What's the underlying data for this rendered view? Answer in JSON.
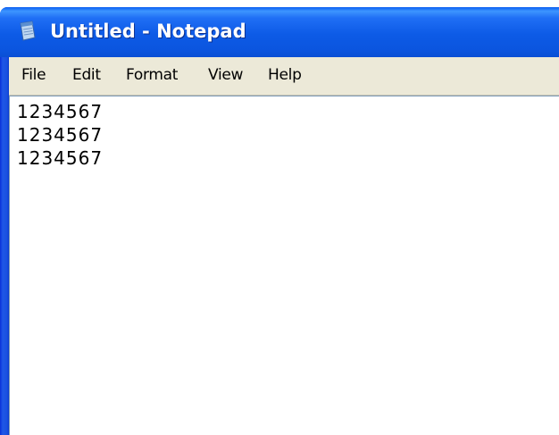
{
  "window": {
    "title": "Untitled - Notepad",
    "icon": "notepad-icon"
  },
  "menu": {
    "items": [
      {
        "label": "File"
      },
      {
        "label": "Edit"
      },
      {
        "label": "Format"
      },
      {
        "label": "View"
      },
      {
        "label": "Help"
      }
    ]
  },
  "editor": {
    "lines": [
      "1234567",
      "1234567",
      "1234567"
    ]
  },
  "colors": {
    "titlebar": "#0b55df",
    "menubar": "#ece9d8",
    "editor_background": "#ffffff"
  }
}
